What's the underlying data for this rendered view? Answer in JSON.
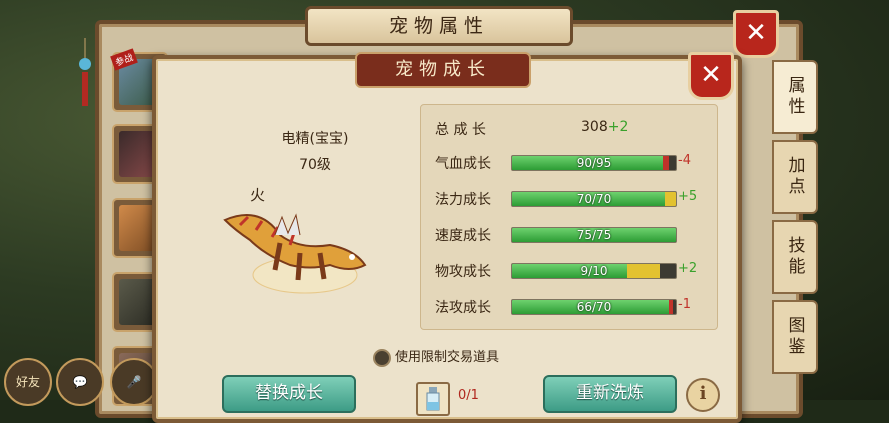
{
  "outer_window": {
    "title": "宠物属性",
    "close_icon": "close-icon"
  },
  "side_tabs": [
    {
      "label": "属性",
      "active": true
    },
    {
      "label": "加点",
      "active": false
    },
    {
      "label": "技能",
      "active": false
    },
    {
      "label": "图鉴",
      "active": false
    }
  ],
  "pet_list": {
    "badge": "参战"
  },
  "bottom_left": {
    "friends_label": "好友"
  },
  "modal": {
    "title": "宠物成长",
    "pet": {
      "name": "电精(宝宝)",
      "level": "70级",
      "element": "火"
    },
    "stats": {
      "total": {
        "label": "总 成 长",
        "value": "308",
        "increase": "+2"
      },
      "rows": [
        {
          "label": "气血成长",
          "text": "90/95",
          "fill": 0.92,
          "ext": 0.04,
          "ext_color": "#c0332a",
          "delta": "-4",
          "delta_color": "#c0332a"
        },
        {
          "label": "法力成长",
          "text": "70/70",
          "fill": 0.93,
          "ext": 0.07,
          "ext_color": "#e2c230",
          "delta": "+5",
          "delta_color": "#3aa12c"
        },
        {
          "label": "速度成长",
          "text": "75/75",
          "fill": 1.0,
          "ext": 0,
          "ext_color": "",
          "delta": "",
          "delta_color": ""
        },
        {
          "label": "物攻成长",
          "text": "9/10",
          "fill": 0.7,
          "ext": 0.2,
          "ext_color": "#e2c230",
          "delta": "+2",
          "delta_color": "#3aa12c"
        },
        {
          "label": "法攻成长",
          "text": "66/70",
          "fill": 0.96,
          "ext": 0.02,
          "ext_color": "#c0332a",
          "delta": "-1",
          "delta_color": "#c0332a"
        }
      ]
    },
    "use_restricted_items_label": "使用限制交易道具",
    "replace_button": "替换成长",
    "item_count": "0/1",
    "rewash_button": "重新洗炼"
  }
}
